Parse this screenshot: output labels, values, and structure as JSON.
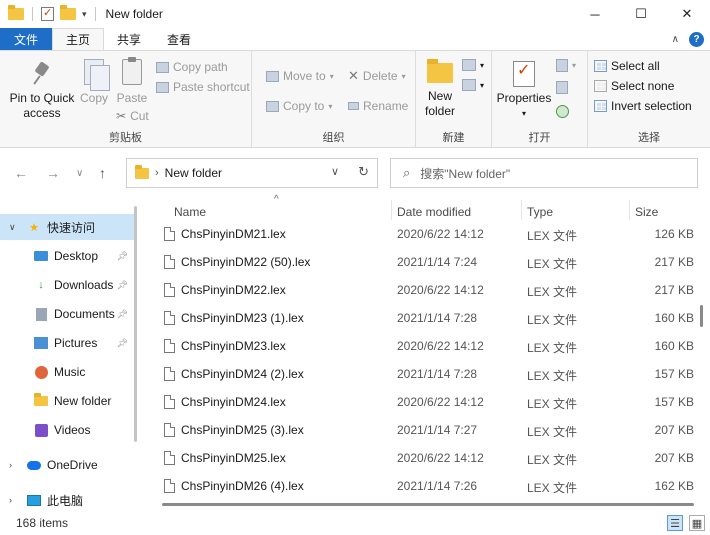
{
  "window": {
    "title": "New folder",
    "controls": {
      "minimize": "─",
      "maximize": "☐",
      "close": "✕"
    }
  },
  "ribbon_tabs": {
    "file": "文件",
    "home": "主页",
    "share": "共享",
    "view": "查看"
  },
  "clipboard": {
    "pin": "Pin to Quick access",
    "copy": "Copy",
    "paste": "Paste",
    "copy_path": "Copy path",
    "paste_shortcut": "Paste shortcut",
    "cut": "Cut",
    "label": "剪贴板"
  },
  "organize": {
    "move_to": "Move to",
    "copy_to": "Copy to",
    "delete": "Delete",
    "rename": "Rename",
    "label": "组织"
  },
  "new_group": {
    "new_folder": "New folder",
    "label": "新建"
  },
  "open_group": {
    "properties": "Properties",
    "label": "打开"
  },
  "select_group": {
    "select_all": "Select all",
    "select_none": "Select none",
    "invert": "Invert selection",
    "label": "选择"
  },
  "address": {
    "path": "New folder"
  },
  "search": {
    "placeholder": "搜索\"New folder\""
  },
  "nav": {
    "quick_access": "快速访问",
    "desktop": "Desktop",
    "downloads": "Downloads",
    "documents": "Documents",
    "pictures": "Pictures",
    "music": "Music",
    "new_folder": "New folder",
    "videos": "Videos",
    "onedrive": "OneDrive",
    "this_pc": "此电脑"
  },
  "columns": {
    "name": "Name",
    "date": "Date modified",
    "type": "Type",
    "size": "Size"
  },
  "files": [
    {
      "name": "ChsPinyinDM21.lex",
      "date": "2020/6/22 14:12",
      "type": "LEX 文件",
      "size": "126 KB"
    },
    {
      "name": "ChsPinyinDM22 (50).lex",
      "date": "2021/1/14 7:24",
      "type": "LEX 文件",
      "size": "217 KB"
    },
    {
      "name": "ChsPinyinDM22.lex",
      "date": "2020/6/22 14:12",
      "type": "LEX 文件",
      "size": "217 KB"
    },
    {
      "name": "ChsPinyinDM23 (1).lex",
      "date": "2021/1/14 7:28",
      "type": "LEX 文件",
      "size": "160 KB"
    },
    {
      "name": "ChsPinyinDM23.lex",
      "date": "2020/6/22 14:12",
      "type": "LEX 文件",
      "size": "160 KB"
    },
    {
      "name": "ChsPinyinDM24 (2).lex",
      "date": "2021/1/14 7:28",
      "type": "LEX 文件",
      "size": "157 KB"
    },
    {
      "name": "ChsPinyinDM24.lex",
      "date": "2020/6/22 14:12",
      "type": "LEX 文件",
      "size": "157 KB"
    },
    {
      "name": "ChsPinyinDM25 (3).lex",
      "date": "2021/1/14 7:27",
      "type": "LEX 文件",
      "size": "207 KB"
    },
    {
      "name": "ChsPinyinDM25.lex",
      "date": "2020/6/22 14:12",
      "type": "LEX 文件",
      "size": "207 KB"
    },
    {
      "name": "ChsPinyinDM26 (4).lex",
      "date": "2021/1/14 7:26",
      "type": "LEX 文件",
      "size": "162 KB"
    }
  ],
  "status": {
    "count": "168 items"
  },
  "colors": {
    "accent": "#1e6ec8",
    "selection": "#cce4f7",
    "folder": "#f4c542"
  }
}
